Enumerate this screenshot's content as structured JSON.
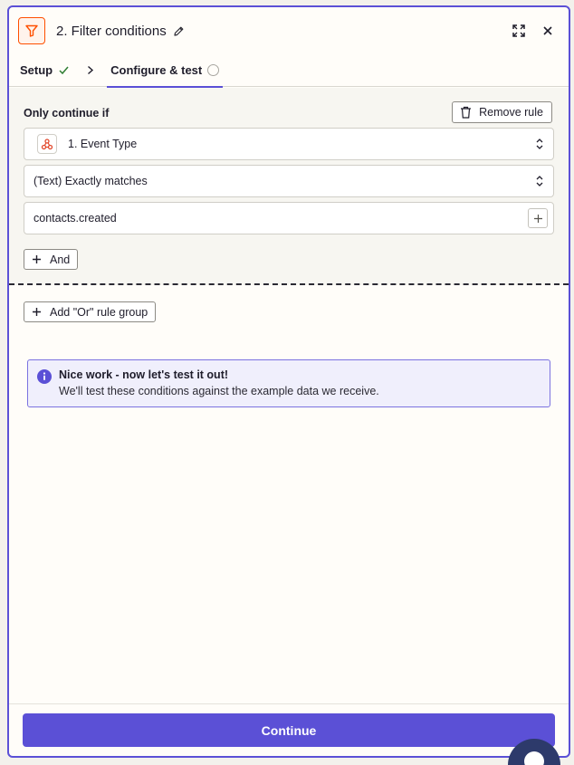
{
  "header": {
    "title": "2. Filter conditions",
    "app_icon": "filter-icon",
    "accent_color": "#ff4f00"
  },
  "tabs": [
    {
      "label": "Setup",
      "status": "complete"
    },
    {
      "label": "Configure & test",
      "status": "incomplete",
      "active": true
    }
  ],
  "rule": {
    "label": "Only continue if",
    "remove_label": "Remove rule",
    "field": "1. Event Type",
    "condition": "(Text) Exactly matches",
    "value": "contacts.created",
    "and_label": "And"
  },
  "or_label": "Add \"Or\" rule group",
  "info": {
    "title": "Nice work - now let's test it out!",
    "text": "We'll test these conditions against the example data we receive."
  },
  "footer": {
    "continue_label": "Continue"
  },
  "colors": {
    "primary": "#5b50d6",
    "success": "#2e7d32"
  }
}
